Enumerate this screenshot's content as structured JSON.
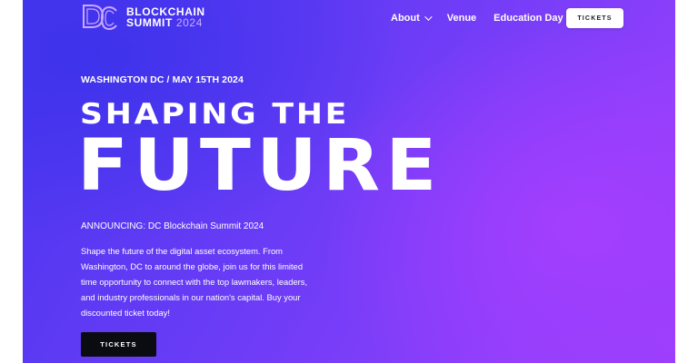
{
  "header": {
    "logo": {
      "line1": "BLOCKCHAIN",
      "line2_bold": "SUMMIT",
      "line2_year": "2024",
      "mark_icon": "dc-logo-mark"
    },
    "nav": {
      "items": [
        {
          "label": "About",
          "has_dropdown": true
        },
        {
          "label": "Venue",
          "has_dropdown": false
        },
        {
          "label": "Education Day",
          "has_dropdown": false
        }
      ],
      "tickets_label": "TICKETS"
    }
  },
  "hero": {
    "location": "WASHINGTON DC / MAY 15TH 2024",
    "headline_line1": "SHAPING THE",
    "headline_line2": "FUTURE",
    "announcement": "ANNOUNCING: DC Blockchain Summit 2024",
    "description": "Shape the future of the digital asset ecosystem. From Washington, DC to around the globe, join us for this limited time opportunity to connect with the top lawmakers, leaders, and industry professionals in our nation's capital.  Buy your discounted ticket today!",
    "tickets_label": "TICKETS"
  },
  "colors": {
    "background_start": "#4a36ef",
    "background_end": "#9a3ffb",
    "logo_accent": "#c9a9ff",
    "hero_button": "#0b0b12",
    "header_button": "#ffffff"
  }
}
